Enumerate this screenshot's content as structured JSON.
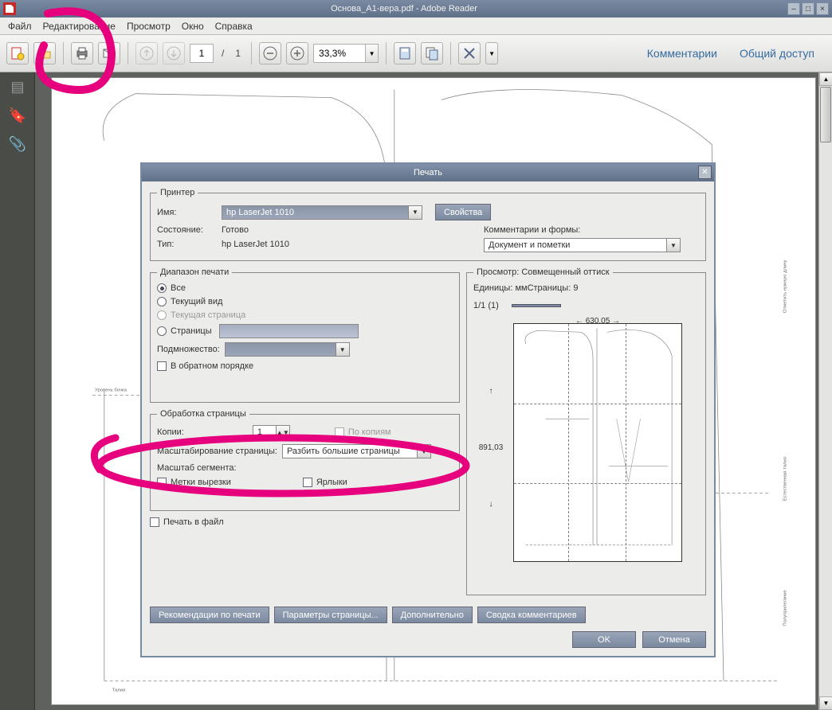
{
  "window": {
    "title": "Основа_А1-вера.pdf - Adobe Reader"
  },
  "menu": {
    "file": "Файл",
    "edit": "Редактирование",
    "view": "Просмотр",
    "window": "Окно",
    "help": "Справка"
  },
  "toolbar": {
    "page_current": "1",
    "page_sep": "/",
    "page_total": "1",
    "zoom": "33,3%",
    "comments": "Комментарии",
    "share": "Общий доступ"
  },
  "document": {
    "side_label": "Уровень бочка",
    "bottom_label": "Талия",
    "right_top": "Отметить нужную длину",
    "right_mid": "Естественная талия",
    "right_bot": "Полуприлегание"
  },
  "dialog": {
    "title": "Печать",
    "printer": {
      "legend": "Принтер",
      "name_label": "Имя:",
      "name_value": "hp LaserJet 1010",
      "status_label": "Состояние:",
      "status_value": "Готово",
      "type_label": "Тип:",
      "type_value": "hp LaserJet 1010",
      "properties_btn": "Свойства",
      "comments_forms_label": "Комментарии и формы:",
      "comments_forms_value": "Документ и пометки"
    },
    "range": {
      "legend": "Диапазон печати",
      "all": "Все",
      "current_view": "Текущий вид",
      "current_page": "Текущая страница",
      "pages": "Страницы",
      "subset": "Подмножество:",
      "reverse": "В обратном порядке"
    },
    "handling": {
      "legend": "Обработка страницы",
      "copies_label": "Копии:",
      "copies_value": "1",
      "collate": "По копиям",
      "scaling_label": "Масштабирование страницы:",
      "scaling_value": "Разбить большие страницы",
      "tile_scale_label": "Масштаб сегмента:",
      "crop_marks": "Метки вырезки",
      "labels": "Ярлыки"
    },
    "print_to_file": "Печать в файл",
    "preview": {
      "legend": "Просмотр: Совмещенный оттиск",
      "units": "Единицы: ммСтраницы: 9",
      "page_indicator": "1/1 (1)",
      "width": "630,05",
      "height": "891,03"
    },
    "buttons": {
      "tips": "Рекомендации по печати",
      "page_setup": "Параметры страницы...",
      "advanced": "Дополнительно",
      "summary": "Сводка комментариев",
      "ok": "OK",
      "cancel": "Отмена"
    }
  }
}
